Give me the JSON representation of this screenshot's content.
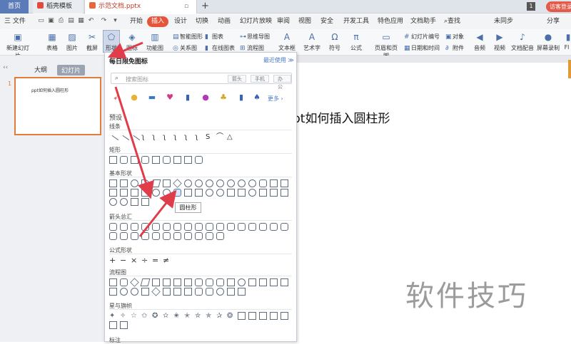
{
  "tabs": {
    "home": "首页",
    "tab1": "稻壳模板",
    "tab2": "示范文档.pptx",
    "page_num": "1",
    "visitor": "访客登录"
  },
  "menu": {
    "file": "三 文件",
    "items": [
      "开始",
      "插入",
      "设计",
      "切换",
      "动画",
      "幻灯片放映",
      "审阅",
      "视图",
      "安全",
      "开发工具",
      "特色应用",
      "文档助手"
    ],
    "search": "查找",
    "sync": "未同步",
    "share": "分享"
  },
  "ribbon": {
    "new_slide": "新建幻灯片",
    "table": "表格",
    "picture": "图片",
    "screenshot": "截屏",
    "shape": "形状",
    "icon_lib": "图标库",
    "func_chart": "功能图",
    "smart_graphic": "智能图形",
    "chart": "图表",
    "mind_map": "思维导图",
    "relation": "关系图",
    "online_chart": "在线图表",
    "flowchart": "流程图",
    "textbox": "文本框",
    "art": "艺术字",
    "symbol": "符号",
    "formula": "公式",
    "header_footer": "页眉和页脚",
    "slide_no": "幻灯片编号",
    "object": "对象",
    "datetime": "日期和时间",
    "attachment": "附件",
    "audio": "音频",
    "video": "视频",
    "doc_audio": "文档配音",
    "screen_record": "屏幕录制",
    "more": "Fl"
  },
  "left_panel": {
    "outline": "大纲",
    "slides": "幻灯片",
    "slide_number": "1",
    "thumb_title": "ppt如何插入圆柱形"
  },
  "slide": {
    "title": "pt如何插入圆柱形"
  },
  "shape_panel": {
    "header": "每日限免图标",
    "recent": "最近使用 ≫",
    "search_placeholder": "搜索图标",
    "chips": [
      "箭头",
      "手机",
      "办公"
    ],
    "more": "更多 ›",
    "sections": {
      "preset": "预设",
      "lines": "线条",
      "rect": "矩形",
      "basic": "基本形状",
      "arrows": "箭头总汇",
      "formula": "公式形状",
      "flow": "流程图",
      "stars": "星与旗帜",
      "callout": "标注"
    },
    "tooltip": "圆柱形"
  },
  "watermark": "软件技巧",
  "colors": {
    "accent": "#e4553c",
    "arrow": "#e03c4a",
    "link": "#4a78c2"
  }
}
